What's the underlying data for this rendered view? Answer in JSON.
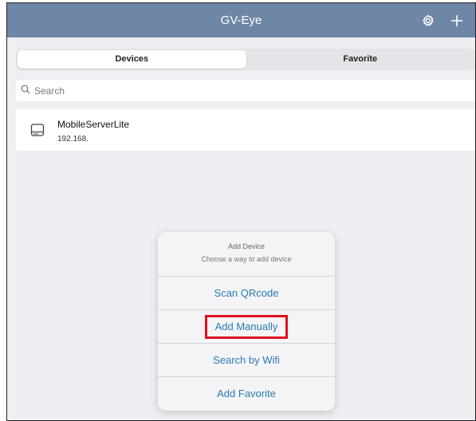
{
  "app": {
    "title": "GV-Eye"
  },
  "navbar": {
    "settings_icon": "gear-icon",
    "add_icon": "plus-icon"
  },
  "tabs": [
    {
      "label": "Devices",
      "active": true
    },
    {
      "label": "Favorite",
      "active": false
    }
  ],
  "search": {
    "placeholder": "Search",
    "value": ""
  },
  "devices": [
    {
      "name": "MobileServerLite",
      "ip": "192.168.",
      "icon": "hard-drive-icon"
    }
  ],
  "action_sheet": {
    "title": "Add Device",
    "subtitle": "Choose a way to add device",
    "actions": [
      {
        "label": "Scan QRcode"
      },
      {
        "label": "Add Manually",
        "highlighted": true
      },
      {
        "label": "Search by Wifi"
      },
      {
        "label": "Add Favorite"
      }
    ]
  },
  "colors": {
    "navbar": "#6f87a6",
    "action_text": "#2b7ab6",
    "highlight_box": "#e01020"
  }
}
